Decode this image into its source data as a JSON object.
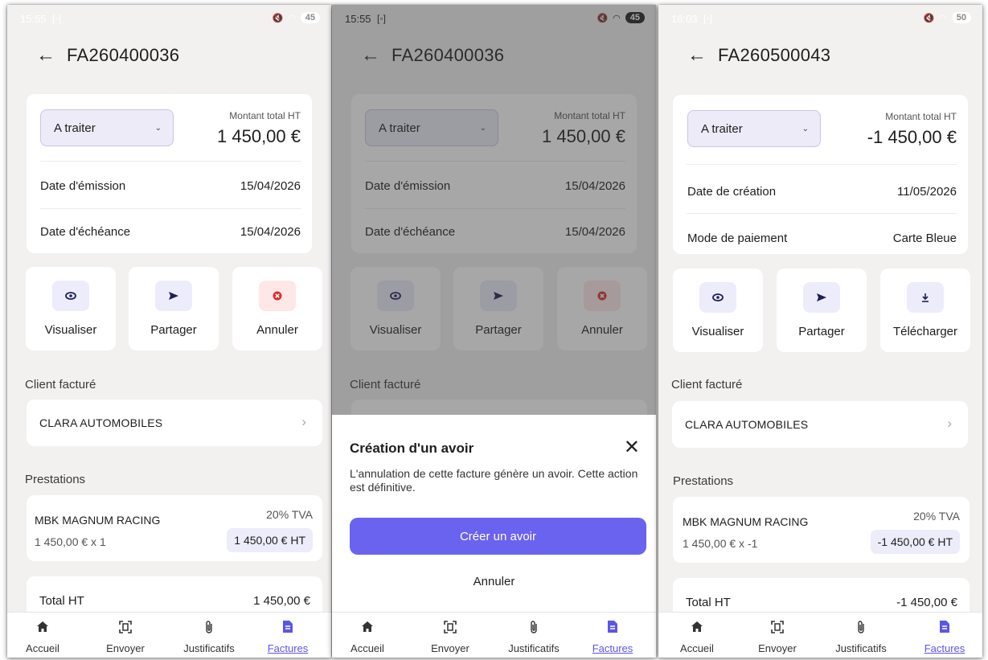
{
  "screens": [
    {
      "status_time": "15:55",
      "battery": "45",
      "title": "FA260400036",
      "status": "A traiter",
      "amount_label": "Montant total HT",
      "amount": "1 450,00 €",
      "rows": [
        {
          "label": "Date d'émission",
          "value": "15/04/2026"
        },
        {
          "label": "Date d'échéance",
          "value": "15/04/2026"
        }
      ],
      "actions": [
        {
          "label": "Visualiser",
          "icon": "eye-icon"
        },
        {
          "label": "Partager",
          "icon": "send-icon"
        },
        {
          "label": "Annuler",
          "icon": "cancel-icon"
        }
      ],
      "client_section": "Client facturé",
      "client_name": "CLARA AUTOMOBILES",
      "prestations_section": "Prestations",
      "presta_name": "MBK MAGNUM RACING",
      "presta_tva": "20% TVA",
      "presta_qty": "1 450,00 € x 1",
      "presta_ht": "1 450,00 € HT",
      "total_label": "Total HT",
      "total_value": "1 450,00 €"
    },
    {
      "status_time": "15:55",
      "battery": "45",
      "title": "FA260400036",
      "status": "A traiter",
      "amount_label": "Montant total HT",
      "amount": "1 450,00 €",
      "rows": [
        {
          "label": "Date d'émission",
          "value": "15/04/2026"
        },
        {
          "label": "Date d'échéance",
          "value": "15/04/2026"
        }
      ],
      "actions": [
        {
          "label": "Visualiser",
          "icon": "eye-icon"
        },
        {
          "label": "Partager",
          "icon": "send-icon"
        },
        {
          "label": "Annuler",
          "icon": "cancel-icon"
        }
      ],
      "client_section": "Client facturé",
      "sheet": {
        "title": "Création d'un avoir",
        "text": "L'annulation de cette facture génère un avoir. Cette action est définitive.",
        "primary": "Créer un avoir",
        "secondary": "Annuler"
      }
    },
    {
      "status_time": "16:03",
      "battery": "50",
      "title": "FA260500043",
      "status": "A traiter",
      "amount_label": "Montant total HT",
      "amount": "-1 450,00 €",
      "rows": [
        {
          "label": "Date de création",
          "value": "11/05/2026"
        },
        {
          "label": "Mode de paiement",
          "value": "Carte Bleue"
        }
      ],
      "actions": [
        {
          "label": "Visualiser",
          "icon": "eye-icon"
        },
        {
          "label": "Partager",
          "icon": "send-icon"
        },
        {
          "label": "Télécharger",
          "icon": "download-icon"
        }
      ],
      "client_section": "Client facturé",
      "client_name": "CLARA AUTOMOBILES",
      "prestations_section": "Prestations",
      "presta_name": "MBK MAGNUM RACING",
      "presta_tva": "20% TVA",
      "presta_qty": "1 450,00 € x -1",
      "presta_ht": "-1 450,00 € HT",
      "total_label": "Total HT",
      "total_value": "-1 450,00 €"
    }
  ],
  "nav": [
    {
      "label": "Accueil",
      "icon": "home-icon"
    },
    {
      "label": "Envoyer",
      "icon": "scan-icon"
    },
    {
      "label": "Justificatifs",
      "icon": "paperclip-icon"
    },
    {
      "label": "Factures",
      "icon": "invoice-icon",
      "active": true
    }
  ],
  "colors": {
    "accent": "#5b56e8",
    "button": "#6a63f0",
    "danger_badge": "#fde7e7",
    "badge": "#ececfb",
    "background": "#f2f1f0"
  }
}
